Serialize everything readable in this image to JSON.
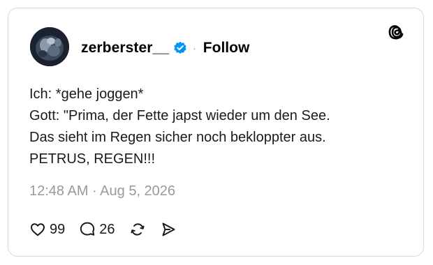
{
  "post": {
    "username": "zerberster__",
    "separator": "·",
    "follow_label": "Follow",
    "lines": [
      "Ich: *gehe joggen*",
      "Gott: \"Prima, der Fette japst wieder um den See.",
      "Das sieht im Regen sicher noch bekloppter aus.",
      "PETRUS, REGEN!!!"
    ],
    "timestamp": "12:48 AM · Aug 5, 2026"
  },
  "actions": {
    "like": {
      "icon": "heart-icon",
      "count": "99"
    },
    "reply": {
      "icon": "speech-bubble-icon",
      "count": "26"
    },
    "repost": {
      "icon": "repost-icon"
    },
    "share": {
      "icon": "send-icon"
    }
  },
  "brand": {
    "logo": "threads-logo-icon",
    "verified_color": "#0095f6"
  }
}
